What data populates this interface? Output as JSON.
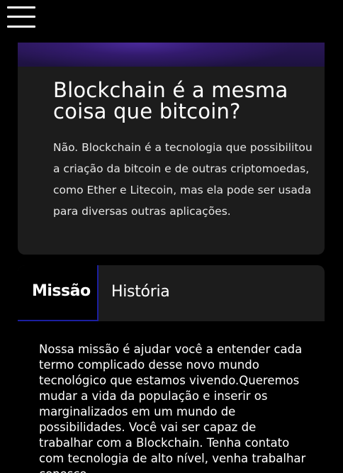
{
  "header": {
    "menu_icon": "hamburger-menu-icon"
  },
  "faq_card": {
    "title": "Blockchain é a mesma coisa que bitcoin?",
    "text": "Não. Blockchain é a tecnologia que possibilitou a criação da bitcoin e de outras criptomoedas, como Ether e Litecoin, mas ela pode ser usada para diversas outras aplicações.",
    "accent_color": "#4a2a9a"
  },
  "tabs": {
    "items": [
      {
        "label": "Missão",
        "active": true
      },
      {
        "label": "História",
        "active": false
      }
    ],
    "active_border_color": "#1b1fa0",
    "content": "Nossa missão é ajudar você a entender cada termo complicado desse novo mundo tecnológico que estamos vivendo.Queremos mudar a vida da população e inserir os marginalizados em um mundo de possibilidades. Você vai ser capaz de trabalhar com a Blockchain. Tenha contato com tecnologia de alto nível, venha trabalhar conosco."
  }
}
